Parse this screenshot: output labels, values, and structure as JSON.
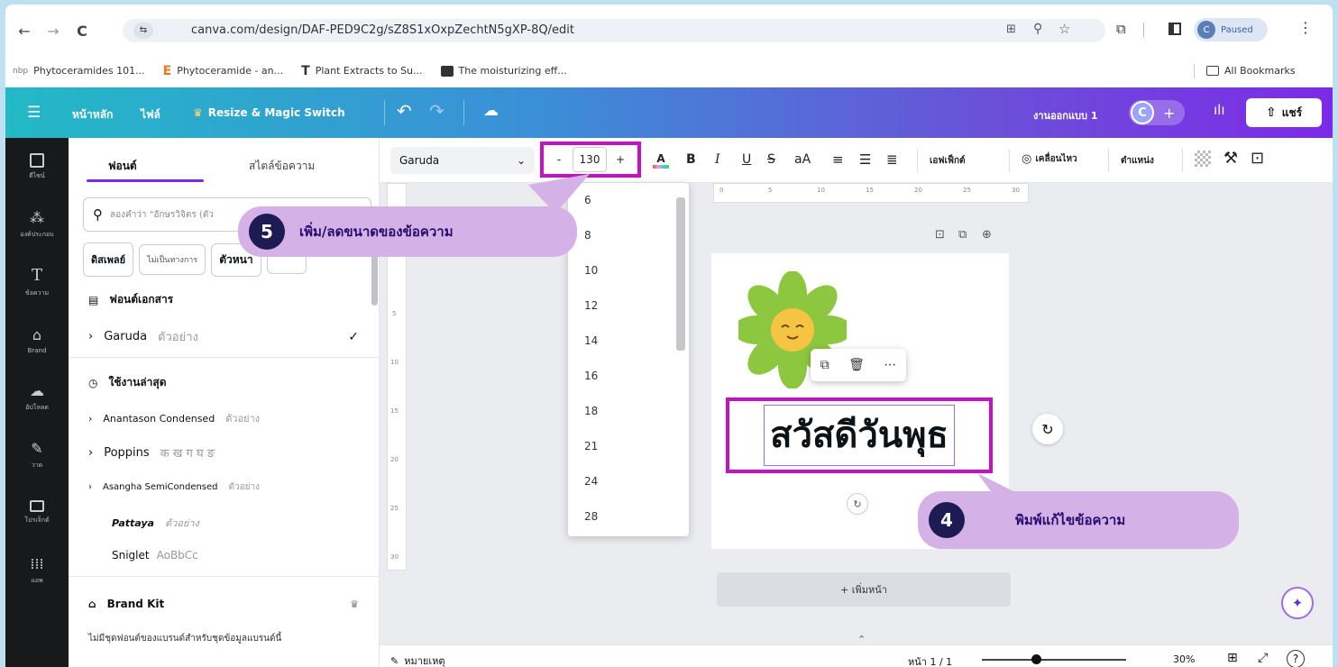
{
  "browser": {
    "url": "canva.com/design/DAF-PED9C2g/sZ8S1xOxpZechtN5gXP-8Q/edit",
    "profile_label": "Paused",
    "profile_initial": "C",
    "bookmarks": [
      "Phytoceramides 101...",
      "Phytoceramide - an...",
      "Plant Extracts to Su...",
      "The moisturizing eff..."
    ],
    "all_bookmarks": "All Bookmarks"
  },
  "header": {
    "home": "หน้าหลัก",
    "file": "ไฟล์",
    "resize": "Resize & Magic Switch",
    "design_name": "งานออกแบบ 1",
    "avatar_initial": "C",
    "share": "แชร์"
  },
  "rail": [
    "ดีไซน์",
    "องค์ประกอบ",
    "ข้อความ",
    "Brand",
    "อัปโหลด",
    "วาด",
    "โปรเจ็กต์",
    "แอพ"
  ],
  "panel": {
    "tabs": [
      "ฟอนต์",
      "สไตล์ข้อความ"
    ],
    "search_placeholder": "ลองคำว่า \"อักษรวิจิตร (ตัว",
    "chips": [
      "ดิสเพลย์",
      "ไม่เป็นทางการ",
      "ตัวหนา"
    ],
    "doc_fonts": "ฟอนต์เอกสาร",
    "current_font": "Garuda",
    "current_font_sample": "ตัวอย่าง",
    "recent": "ใช้งานล่าสุด",
    "fonts": [
      {
        "name": "Anantason Condensed",
        "sample": "ตัวอย่าง"
      },
      {
        "name": "Poppins",
        "sample": "क ख ग घ ङ"
      },
      {
        "name": "Asangha SemiCondensed",
        "sample": "ตัวอย่าง"
      },
      {
        "name": "Pattaya",
        "sample": "ตัวอย่าง"
      },
      {
        "name": "Sniglet",
        "sample": "AoBbCc"
      }
    ],
    "brand_kit": "Brand Kit",
    "brand_note": "ไม่มีชุดฟอนต์ของแบรนด์สำหรับชุดข้อมูลแบรนด์นี้"
  },
  "toolbar": {
    "font": "Garuda",
    "size": "130",
    "minus": "-",
    "plus": "+",
    "effects": "เอฟเฟ็กต์",
    "animate": "เคลื่อนไหว",
    "position": "ตำแหน่ง",
    "case": "aA"
  },
  "size_options": [
    "6",
    "8",
    "10",
    "12",
    "14",
    "16",
    "18",
    "21",
    "24",
    "28"
  ],
  "ruler_ticks": [
    "0",
    "5",
    "10",
    "15",
    "20",
    "25",
    "30"
  ],
  "vruler_ticks": [
    "5",
    "10",
    "15",
    "20",
    "25",
    "30"
  ],
  "canvas": {
    "text": "สวัสดีวันพุธ",
    "add_page": "+ เพิ่มหน้า"
  },
  "callouts": {
    "step5_num": "5",
    "step5_text": "เพิ่ม/ลดขนาดของข้อความ",
    "step4_num": "4",
    "step4_text": "พิมพ์แก้ไขข้อความ"
  },
  "footer": {
    "notes": "หมายเหตุ",
    "page": "หน้า 1 / 1",
    "zoom": "30%",
    "zoom_level": 0.3
  },
  "colors": {
    "highlight": "#c411c6",
    "callout": "#d4b1e6",
    "badge": "#1d1b53",
    "flower": "#8dc63f"
  }
}
